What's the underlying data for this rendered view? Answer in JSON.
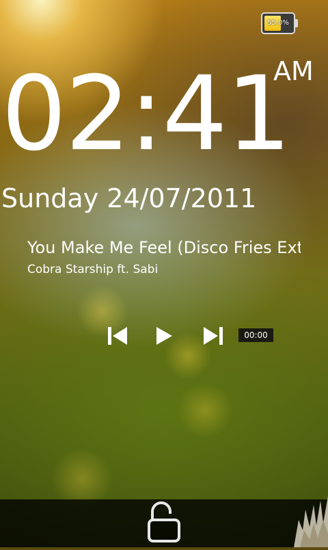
{
  "status": {
    "battery_percent": "55.0%",
    "battery_level": 0.55
  },
  "clock": {
    "time": "02:41",
    "meridiem": "AM"
  },
  "date": "Sunday 24/07/2011",
  "music": {
    "title": "You Make Me Feel (Disco Fries Extended Mix)",
    "artist": "Cobra Starship ft. Sabi",
    "elapsed": "00:00"
  },
  "icons": {
    "previous": "skip-previous-icon",
    "play": "play-icon",
    "next": "skip-next-icon",
    "unlock": "unlock-padlock-icon",
    "battery": "battery-icon"
  }
}
